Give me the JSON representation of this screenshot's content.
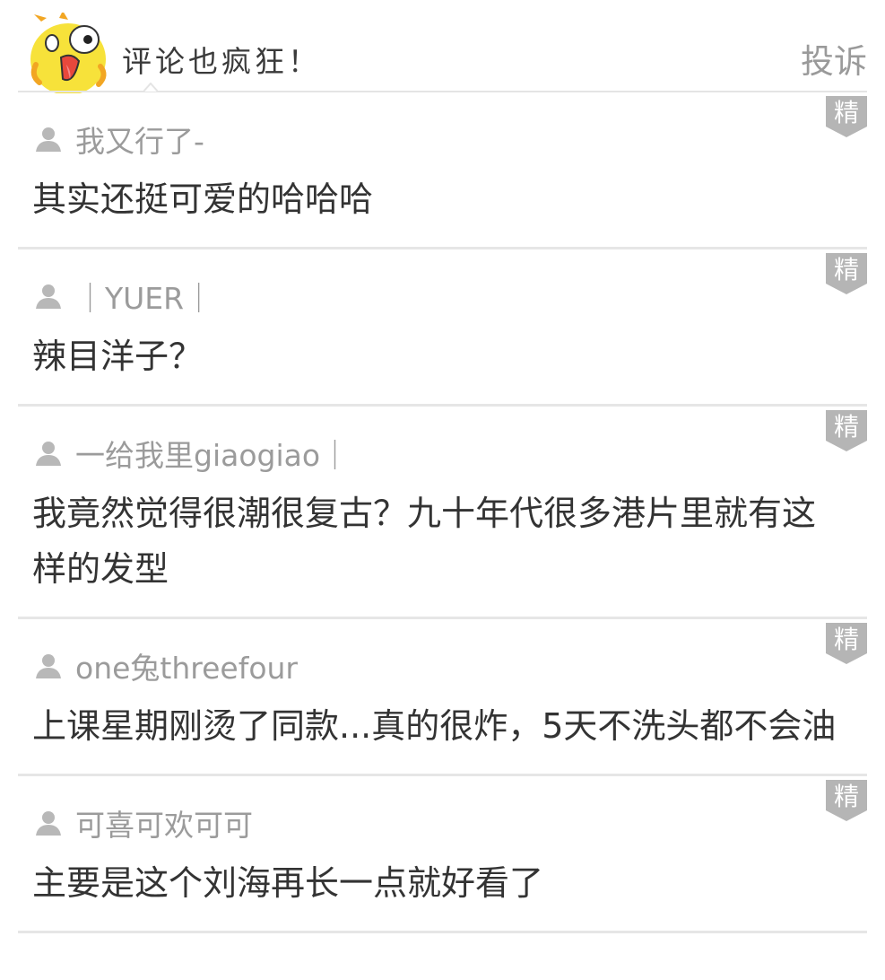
{
  "header": {
    "title": "评论也疯狂！",
    "report_label": "投诉",
    "mascot_icon": "yellow-chick-mascot"
  },
  "badge_label": "精",
  "colors": {
    "badge_bg": "#b5b5b5",
    "text_primary": "#333333",
    "text_secondary": "#9b9b9b",
    "divider": "#e6e6e6",
    "mascot_yellow": "#f7e23a"
  },
  "comments": [
    {
      "author": "我又行了-",
      "text": "其实还挺可爱的哈哈哈",
      "featured": true
    },
    {
      "author": "｜YUER｜",
      "text": "辣目洋子？",
      "featured": true
    },
    {
      "author": "一给我里giaogiao｜",
      "text": "我竟然觉得很潮很复古？九十年代很多港片里就有这样的发型",
      "featured": true
    },
    {
      "author": "one兔threefour",
      "text": "上课星期刚烫了同款...真的很炸，5天不洗头都不会油",
      "featured": true
    },
    {
      "author": "可喜可欢可可",
      "text": "主要是这个刘海再长一点就好看了",
      "featured": true
    }
  ]
}
